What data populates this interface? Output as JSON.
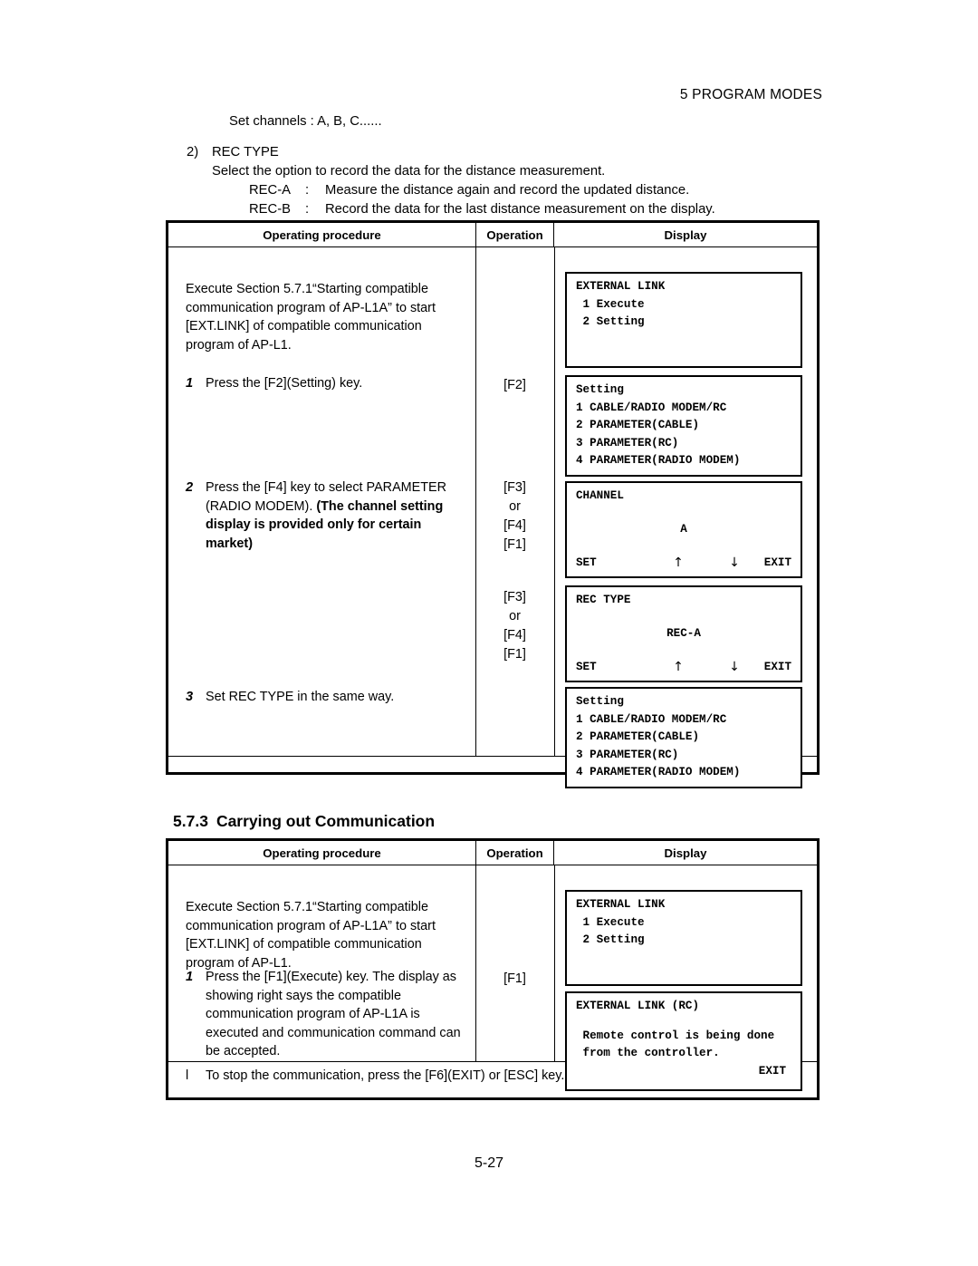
{
  "header": {
    "running_head": "5 PROGRAM MODES"
  },
  "intro": {
    "set_channels": "Set channels : A, B, C......",
    "item_number": "2)",
    "item_title": "REC TYPE",
    "item_desc": "Select the option to record the data for the distance measurement.",
    "rec_a_key": "REC-A",
    "rec_a_colon": ":",
    "rec_a_desc": "Measure the distance again and record the updated distance.",
    "rec_b_key": "REC-B",
    "rec_b_colon": ":",
    "rec_b_desc": "Record the data for the last distance measurement on the display."
  },
  "table1": {
    "headers": {
      "procedure": "Operating procedure",
      "operation": "Operation",
      "display": "Display"
    },
    "intro_para": "Execute Section 5.7.1“Starting compatible communication program of AP-L1A” to start [EXT.LINK] of compatible communication program of AP-L1.",
    "steps": [
      {
        "no": "1",
        "text": "Press the [F2](Setting) key.",
        "bold_text": "",
        "operation": "[F2]"
      },
      {
        "no": "2",
        "text": "Press the [F4] key to select PARAMETER (RADIO MODEM).",
        "bold_text": "(The channel setting display is provided only for certain market)",
        "operation_lines": [
          "[F3]",
          "or",
          "[F4]",
          "[F1]"
        ]
      },
      {
        "no": "3",
        "text": "Set REC TYPE in the same way.",
        "bold_text": "",
        "operation": ""
      }
    ],
    "operation_block2": [
      "[F3]",
      "or",
      "[F4]",
      "[F1]"
    ],
    "screens": {
      "external_link": {
        "title": "EXTERNAL LINK",
        "lines": [
          " 1 Execute",
          " 2 Setting"
        ]
      },
      "setting": {
        "title": "Setting",
        "lines": [
          "1 CABLE/RADIO MODEM/RC",
          "2 PARAMETER(CABLE)",
          "3 PARAMETER(RC)",
          "4 PARAMETER(RADIO MODEM)"
        ]
      },
      "channel": {
        "title": "CHANNEL",
        "value": "A",
        "softkeys": [
          "SET",
          "↑",
          "↓",
          "EXIT"
        ]
      },
      "rec_type": {
        "title": "REC TYPE",
        "value": "REC-A",
        "softkeys": [
          "SET",
          "↑",
          "↓",
          "EXIT"
        ]
      },
      "setting2": {
        "title": "Setting",
        "lines": [
          "1 CABLE/RADIO MODEM/RC",
          "2 PARAMETER(CABLE)",
          "3 PARAMETER(RC)",
          "4 PARAMETER(RADIO MODEM)"
        ]
      }
    }
  },
  "section": {
    "number": "5.7.3",
    "title": "Carrying out Communication"
  },
  "table2": {
    "headers": {
      "procedure": "Operating procedure",
      "operation": "Operation",
      "display": "Display"
    },
    "intro_para": "Execute Section 5.7.1“Starting compatible communication program of AP-L1A” to start [EXT.LINK] of compatible communication program of AP-L1.",
    "step1": {
      "no": "1",
      "text": "Press the [F1](Execute) key. The display as showing right says the compatible communication program of AP-L1A is executed and communication command can be accepted.",
      "operation": "[F1]"
    },
    "note": {
      "marker": "l",
      "text": "To stop the communication, press the [F6](EXIT) or [ESC] key."
    },
    "screens": {
      "external_link": {
        "title": "EXTERNAL LINK",
        "lines": [
          " 1 Execute",
          " 2 Setting"
        ]
      },
      "external_link_rc": {
        "title": "EXTERNAL LINK (RC)",
        "line1": " Remote control is being done",
        "line2": " from the controller.",
        "softkey": "EXIT"
      }
    }
  },
  "footer": {
    "page_number": "5-27"
  }
}
